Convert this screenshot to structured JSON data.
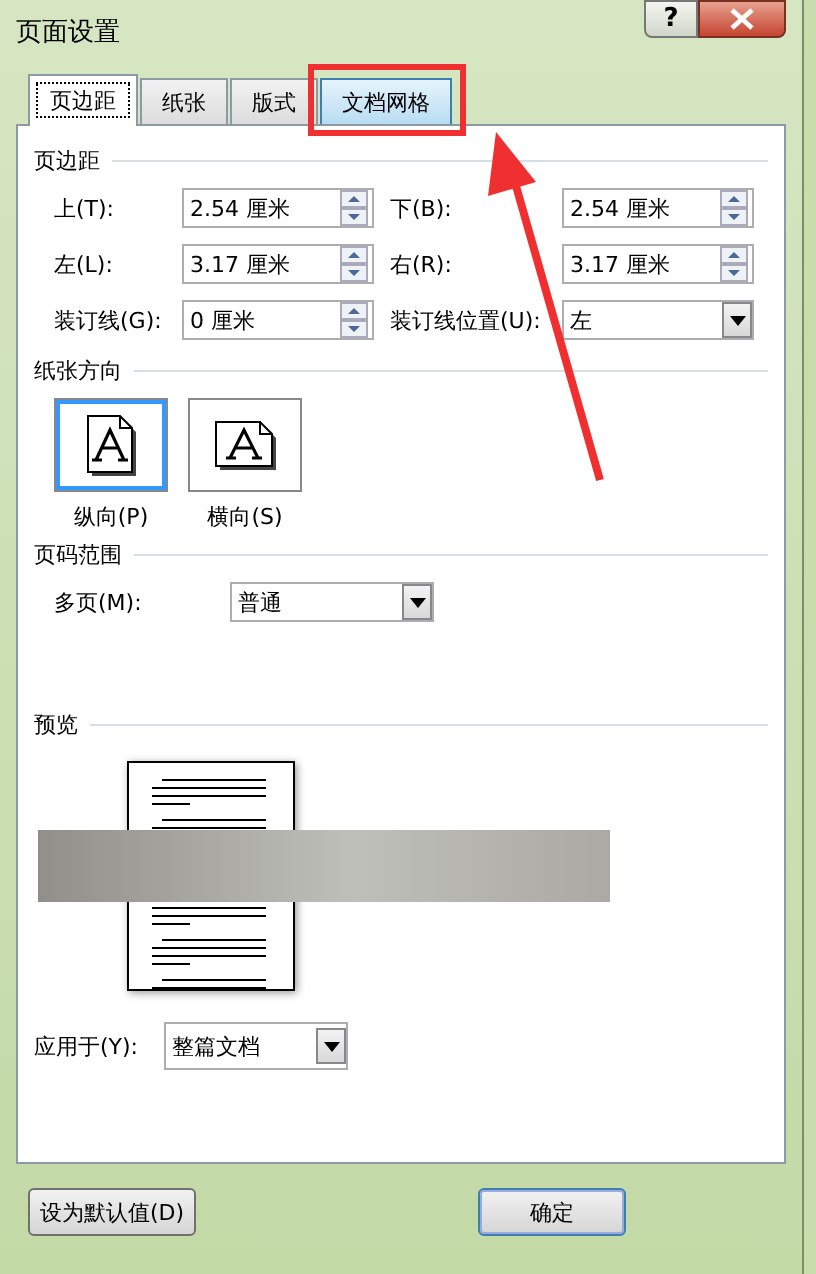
{
  "window": {
    "title": "页面设置",
    "help_button": "?"
  },
  "tabs": [
    {
      "label": "页边距",
      "selected": true,
      "annotated": false
    },
    {
      "label": "纸张",
      "selected": false,
      "annotated": false
    },
    {
      "label": "版式",
      "selected": false,
      "annotated": false
    },
    {
      "label": "文档网格",
      "selected": false,
      "annotated": true
    }
  ],
  "margins": {
    "title": "页边距",
    "fields": [
      {
        "label": "上(T):",
        "value": "2.54 厘米",
        "kind": "spin"
      },
      {
        "label": "下(B):",
        "value": "2.54 厘米",
        "kind": "spin"
      },
      {
        "label": "左(L):",
        "value": "3.17 厘米",
        "kind": "spin"
      },
      {
        "label": "右(R):",
        "value": "3.17 厘米",
        "kind": "spin"
      },
      {
        "label": "装订线(G):",
        "value": "0 厘米",
        "kind": "spin"
      },
      {
        "label": "装订线位置(U):",
        "value": "左",
        "kind": "dropdown"
      }
    ]
  },
  "orientation": {
    "title": "纸张方向",
    "options": [
      {
        "label": "纵向(P)",
        "selected": true,
        "kind": "portrait"
      },
      {
        "label": "横向(S)",
        "selected": false,
        "kind": "landscape"
      }
    ]
  },
  "pages": {
    "title": "页码范围",
    "label": "多页(M):",
    "value": "普通"
  },
  "preview": {
    "title": "预览",
    "redacted": true
  },
  "apply": {
    "label": "应用于(Y):",
    "value": "整篇文档"
  },
  "buttons": [
    "设为默认值(D)",
    "确定"
  ]
}
